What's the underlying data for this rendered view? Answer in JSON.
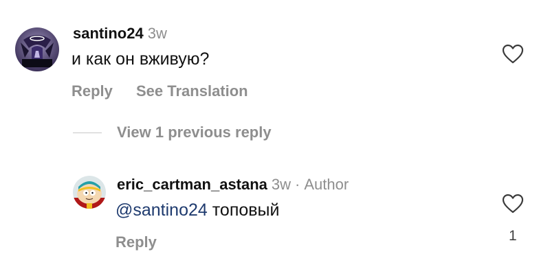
{
  "comments": [
    {
      "username": "santino24",
      "time": "3w",
      "text": "и как он вживую?",
      "reply_label": "Reply",
      "translate_label": "See Translation"
    }
  ],
  "view_replies_label": "View 1 previous reply",
  "reply": {
    "username": "eric_cartman_astana",
    "time": "3w",
    "separator": "·",
    "author_badge": "Author",
    "mention": "@santino24",
    "text": "топовый",
    "reply_label": "Reply",
    "like_count": "1"
  },
  "icons": {
    "heart": "heart-outline-icon",
    "avatar1": "avatar-santino24",
    "avatar2": "avatar-eric-cartman"
  },
  "colors": {
    "text": "#111111",
    "secondary": "#8e8e8e",
    "mention": "#1e3a6e"
  }
}
